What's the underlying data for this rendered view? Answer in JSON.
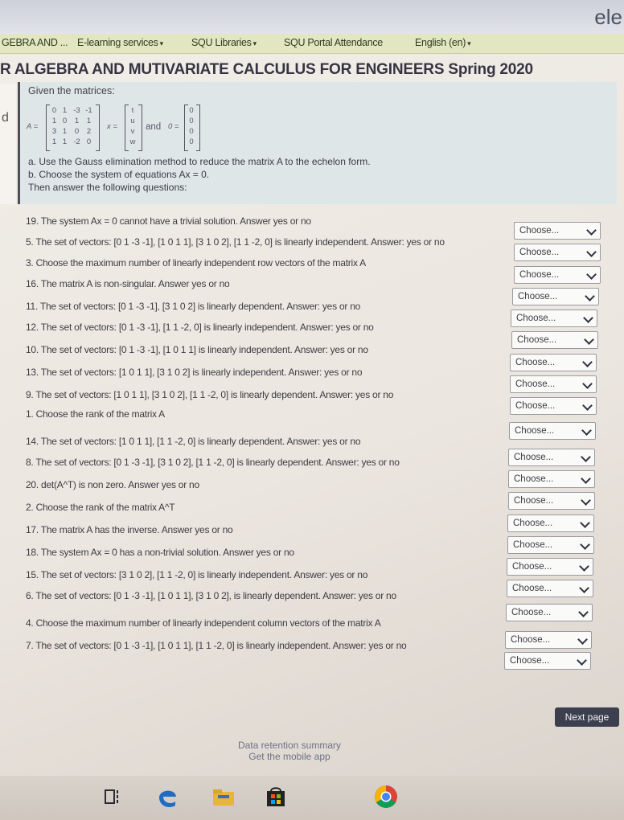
{
  "browser": {
    "corner_text": "ele"
  },
  "nav": {
    "items": [
      {
        "label": "GEBRA AND ...",
        "has_menu": false
      },
      {
        "label": "E-learning services",
        "has_menu": true
      },
      {
        "label": "SQU Libraries",
        "has_menu": true
      },
      {
        "label": "SQU Portal Attendance",
        "has_menu": false
      },
      {
        "label": "English (en)",
        "has_menu": true
      }
    ]
  },
  "course_title": "R ALGEBRA AND MUTIVARIATE CALCULUS FOR ENGINEERS Spring 2020",
  "question": {
    "given": "Given the matrices:",
    "matrix_A_label": "A =",
    "matrix_A": [
      [
        "0",
        "1",
        "-3",
        "-1"
      ],
      [
        "1",
        "0",
        "1",
        "1"
      ],
      [
        "3",
        "1",
        "0",
        "2"
      ],
      [
        "1",
        "1",
        "-2",
        "0"
      ]
    ],
    "matrix_x_label": "x =",
    "vector_x": [
      "t",
      "u",
      "v",
      "w"
    ],
    "and_label": "and",
    "zero_label": "0 =",
    "vector_zero": [
      "0",
      "0",
      "0",
      "0"
    ],
    "instruction_a": "a. Use the Gauss elimination method to reduce the matrix A to the echelon form.",
    "instruction_b": "b. Choose the system of equations Ax = 0.",
    "instruction_then": "Then answer the following questions:"
  },
  "select_placeholder": "Choose...",
  "items": [
    {
      "text": "19. The system Ax = 0 cannot have a trivial solution. Answer yes or no"
    },
    {
      "text": "5. The set of vectors: [0 1 -3 -1], [1 0 1 1], [3 1 0 2], [1 1 -2, 0] is linearly independent. Answer: yes or no"
    },
    {
      "text": "3. Choose the maximum number of linearly independent row vectors of the matrix A"
    },
    {
      "text": "16. The matrix A is non-singular. Answer yes or no"
    },
    {
      "text": "11. The set of vectors: [0 1 -3 -1], [3 1 0 2] is linearly dependent. Answer: yes or no"
    },
    {
      "text": "12. The set of vectors: [0 1 -3 -1], [1 1 -2, 0] is linearly independent. Answer: yes or no"
    },
    {
      "text": "10. The set of vectors: [0 1 -3 -1], [1 0 1 1] is linearly independent. Answer: yes or no"
    },
    {
      "text": "13. The set of vectors: [1 0 1 1], [3 1 0 2] is linearly independent. Answer: yes or no"
    },
    {
      "text": "9. The set of vectors: [1 0 1 1], [3 1 0 2], [1 1 -2, 0] is linearly dependent. Answer: yes or no"
    },
    {
      "text": "1. Choose the rank of the matrix A"
    },
    {
      "text": "14. The set of vectors: [1 0 1 1], [1 1 -2, 0] is linearly dependent. Answer: yes or no"
    },
    {
      "text": "8. The set of vectors: [0 1 -3 -1], [3 1 0 2], [1 1 -2, 0] is linearly dependent. Answer: yes or no"
    },
    {
      "text": "20. det(A^T) is non zero. Answer yes or no"
    },
    {
      "text": "2. Choose the rank of the matrix A^T"
    },
    {
      "text": "17. The matrix A has the inverse. Answer yes or no"
    },
    {
      "text": "18. The system Ax = 0 has a non-trivial solution. Answer yes or no"
    },
    {
      "text": "15. The set of vectors: [3 1 0 2], [1 1 -2, 0] is linearly independent. Answer: yes or no"
    },
    {
      "text": "6. The set of vectors: [0 1 -3 -1], [1 0 1 1], [3 1 0 2], is linearly dependent. Answer: yes or no"
    },
    {
      "text": "4. Choose the maximum number of linearly independent column vectors of the matrix A"
    },
    {
      "text": "7. The set of vectors: [0 1 -3 -1], [1 0 1 1], [1 1 -2, 0] is linearly independent. Answer: yes or no"
    }
  ],
  "next_button": "Next page",
  "footer": {
    "data_retention": "Data retention summary",
    "mobile_app": "Get the mobile app"
  },
  "taskbar": {
    "icons": [
      "task-view-icon",
      "edge-icon",
      "file-explorer-icon",
      "store-icon",
      "chrome-icon"
    ]
  }
}
